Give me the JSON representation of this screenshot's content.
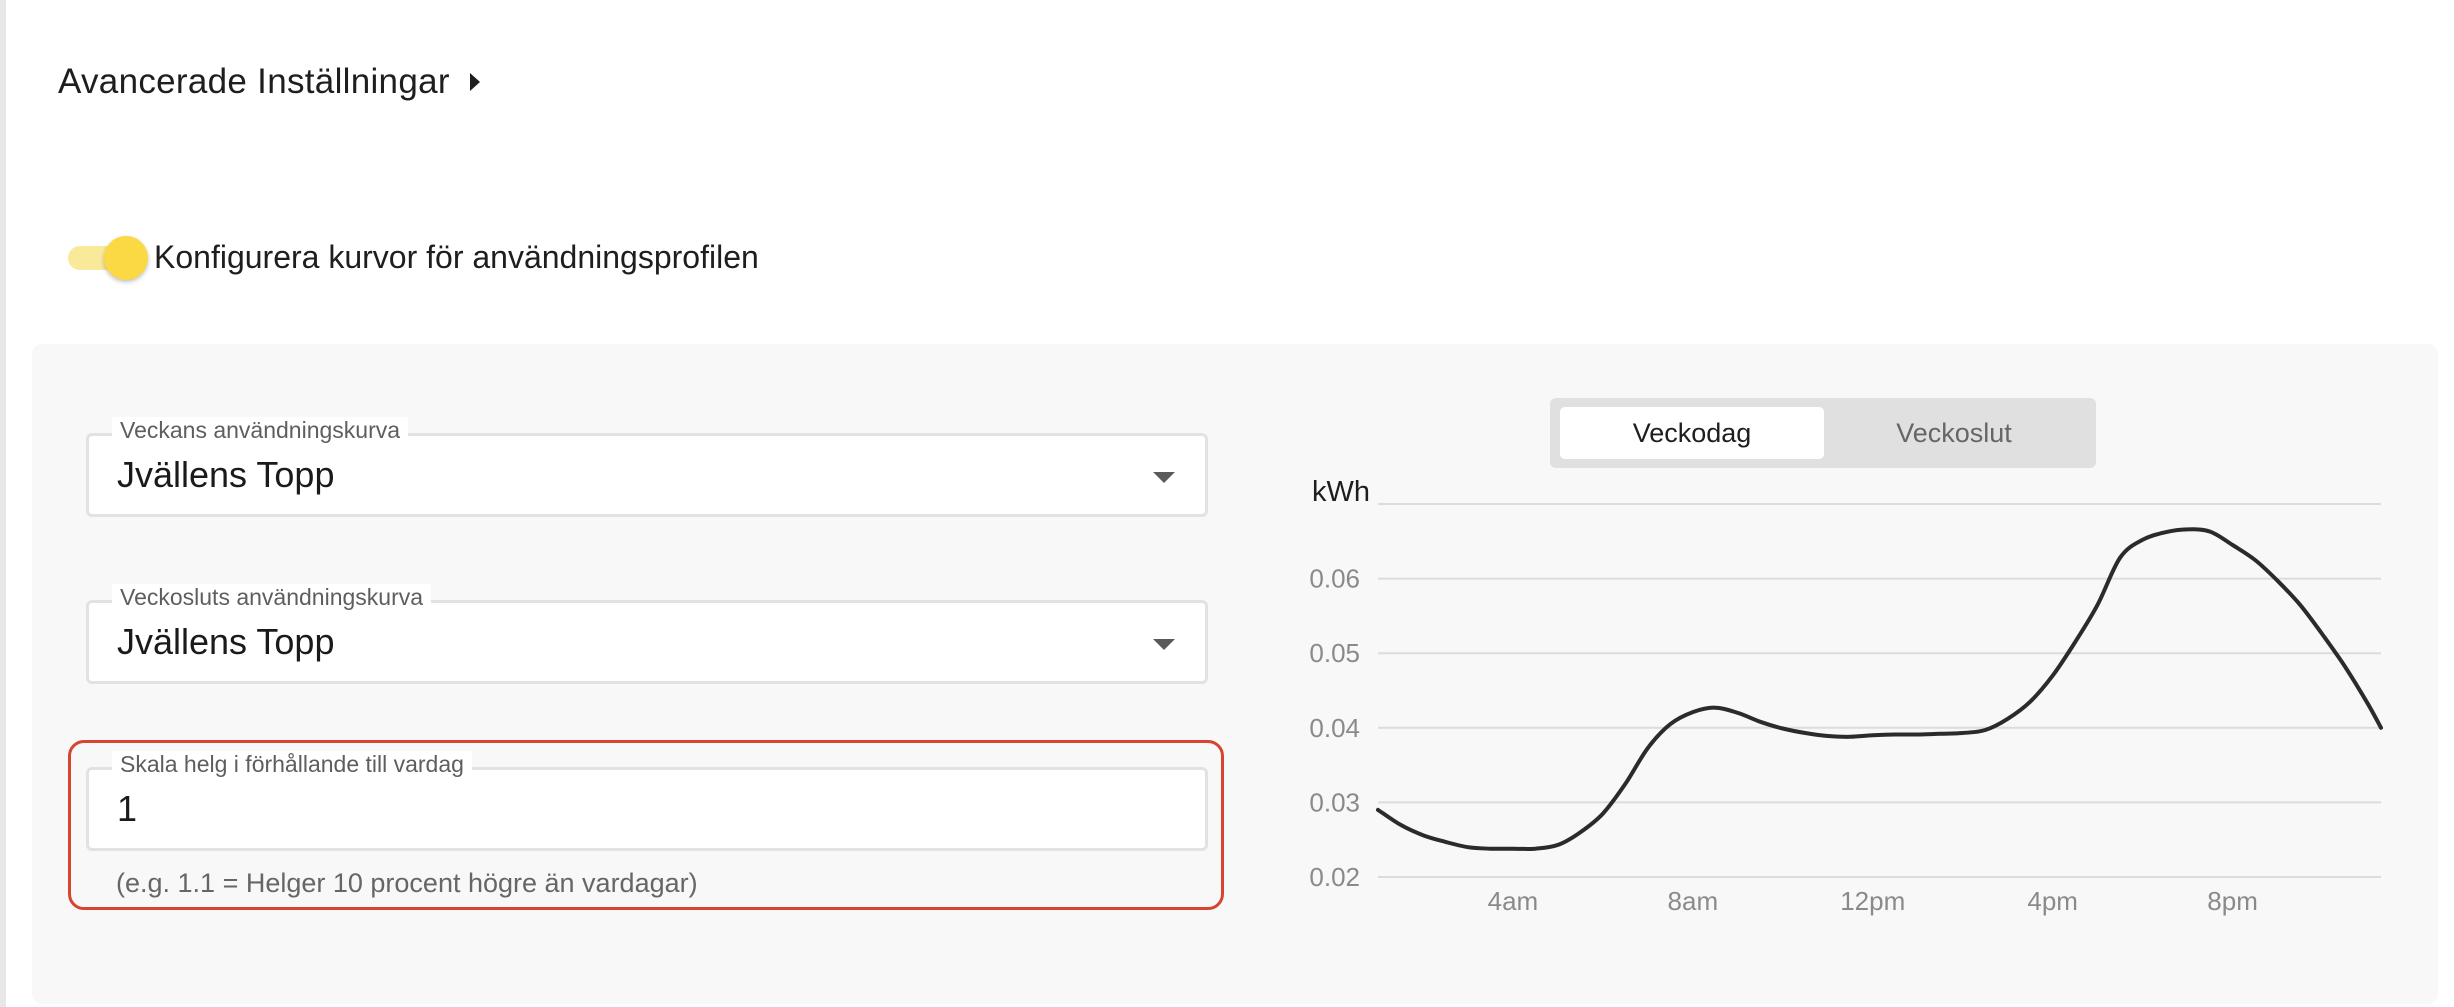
{
  "advanced": {
    "title": "Avancerade Inställningar"
  },
  "toggle": {
    "label": "Konfigurera kurvor för användningsprofilen",
    "on": true
  },
  "weekday_curve": {
    "label": "Veckans användningskurva",
    "value": "Jvällens Topp"
  },
  "weekend_curve": {
    "label": "Veckosluts användningskurva",
    "value": "Jvällens Topp"
  },
  "scale": {
    "label": "Skala helg i förhållande till vardag",
    "value": "1",
    "helper": "(e.g. 1.1 = Helger 10 procent högre än vardagar)"
  },
  "tabs": {
    "weekday": "Veckodag",
    "weekend": "Veckoslut",
    "selected": "weekday"
  },
  "colors": {
    "accent": "#fbd944",
    "error": "#d64531",
    "line": "#2b2b2b"
  },
  "chart_data": {
    "type": "line",
    "ylabel": "kWh",
    "ylim": [
      0.02,
      0.07
    ],
    "yticks": [
      "0.02",
      "0.03",
      "0.04",
      "0.05",
      "0.06"
    ],
    "xticks": [
      {
        "label": "4am",
        "x": 4
      },
      {
        "label": "8am",
        "x": 8
      },
      {
        "label": "12pm",
        "x": 12
      },
      {
        "label": "4pm",
        "x": 16
      },
      {
        "label": "8pm",
        "x": 20
      }
    ],
    "xlim": [
      1,
      23.3
    ],
    "grid": true,
    "series": [
      {
        "x": [
          1,
          1.5,
          2,
          2.5,
          3,
          3.5,
          4,
          4.5,
          5,
          5.5,
          6,
          6.5,
          7,
          7.5,
          8,
          8.5,
          9,
          9.5,
          10,
          10.5,
          11,
          11.5,
          12,
          12.5,
          13,
          13.5,
          14,
          14.5,
          15,
          15.5,
          16,
          16.5,
          17,
          17.5,
          18,
          18.5,
          19,
          19.5,
          20,
          20.5,
          21,
          21.5,
          22,
          22.5,
          23,
          23.3
        ],
        "values": [
          0.029,
          0.027,
          0.0256,
          0.0247,
          0.024,
          0.0238,
          0.0238,
          0.0238,
          0.0243,
          0.026,
          0.0285,
          0.0325,
          0.0373,
          0.0405,
          0.0421,
          0.0427,
          0.042,
          0.0408,
          0.0399,
          0.0393,
          0.0389,
          0.0388,
          0.039,
          0.0391,
          0.0391,
          0.0392,
          0.0393,
          0.0397,
          0.0412,
          0.0435,
          0.047,
          0.0515,
          0.0565,
          0.0628,
          0.0652,
          0.0662,
          0.0666,
          0.0663,
          0.0645,
          0.0625,
          0.0597,
          0.0565,
          0.0525,
          0.0482,
          0.0433,
          0.04
        ]
      }
    ]
  }
}
